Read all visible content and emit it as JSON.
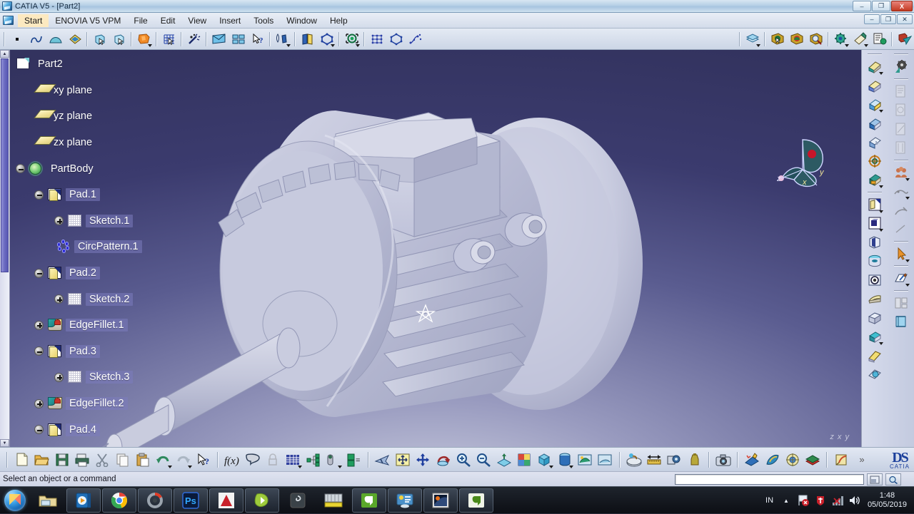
{
  "window": {
    "title": "CATIA V5 - [Part2]",
    "app_icon": "catia-icon",
    "minimize": "–",
    "maximize": "❐",
    "close": "X",
    "doc_minimize": "–",
    "doc_restore": "❐",
    "doc_close": "✕"
  },
  "menubar": {
    "items": [
      {
        "label": "Start",
        "selected": true
      },
      {
        "label": "ENOVIA V5 VPM",
        "selected": false
      },
      {
        "label": "File",
        "selected": false
      },
      {
        "label": "Edit",
        "selected": false
      },
      {
        "label": "View",
        "selected": false
      },
      {
        "label": "Insert",
        "selected": false
      },
      {
        "label": "Tools",
        "selected": false
      },
      {
        "label": "Window",
        "selected": false
      },
      {
        "label": "Help",
        "selected": false
      }
    ]
  },
  "top_toolbar": {
    "groups": [
      {
        "tools": [
          {
            "name": "point-icon"
          },
          {
            "name": "spline-icon"
          },
          {
            "name": "surface-icon"
          },
          {
            "name": "fill-surface-icon"
          }
        ]
      },
      {
        "tools": [
          {
            "name": "select-face-icon"
          },
          {
            "name": "select-solid-icon"
          }
        ]
      },
      {
        "tools": [
          {
            "name": "apply-material-icon",
            "has_caret": true
          }
        ]
      },
      {
        "tools": [
          {
            "name": "grid-select-icon"
          }
        ]
      },
      {
        "tools": [
          {
            "name": "magic-wand-icon"
          }
        ]
      },
      {
        "tools": [
          {
            "name": "email-icon"
          },
          {
            "name": "catalog-icon"
          },
          {
            "name": "whats-this-icon"
          }
        ]
      },
      {
        "tools": [
          {
            "name": "measure-item-icon",
            "has_caret": true
          }
        ]
      },
      {
        "tools": [
          {
            "name": "open-book-icon"
          },
          {
            "name": "polygon-icon",
            "has_caret": true
          }
        ]
      },
      {
        "tools": [
          {
            "name": "sketch-analysis-icon",
            "has_caret": true
          }
        ]
      },
      {
        "tools": [
          {
            "name": "grid-pattern-icon"
          },
          {
            "name": "hexagon-icon"
          },
          {
            "name": "curve-points-icon"
          }
        ]
      },
      {
        "tools": [
          {
            "name": "layers-icon",
            "has_caret": true
          }
        ]
      },
      {
        "tools": [
          {
            "name": "render-scene-icon"
          },
          {
            "name": "apply-color-icon"
          },
          {
            "name": "analyze-render-icon"
          }
        ]
      },
      {
        "tools": [
          {
            "name": "settings-gear-icon",
            "has_caret": true
          },
          {
            "name": "annotation-icon",
            "has_caret": true
          },
          {
            "name": "catalog-browser-icon"
          }
        ]
      },
      {
        "tools": [
          {
            "name": "send-to-icon"
          }
        ]
      }
    ]
  },
  "spec_tree": {
    "root_label": "Part2",
    "nodes": [
      {
        "label": "Part2",
        "icon": "part-icon",
        "indent": 0,
        "toggle": "none",
        "highlight": false
      },
      {
        "label": "xy plane",
        "icon": "plane-icon",
        "indent": 1,
        "toggle": "none",
        "highlight": false
      },
      {
        "label": "yz plane",
        "icon": "plane-icon",
        "indent": 1,
        "toggle": "none",
        "highlight": false
      },
      {
        "label": "zx plane",
        "icon": "plane-icon",
        "indent": 1,
        "toggle": "none",
        "highlight": false
      },
      {
        "label": "PartBody",
        "icon": "partbody-icon",
        "indent": 1,
        "toggle": "minus",
        "highlight": false
      },
      {
        "label": "Pad.1",
        "icon": "pad-icon",
        "indent": 2,
        "toggle": "minus",
        "highlight": true
      },
      {
        "label": "Sketch.1",
        "icon": "sketch-icon",
        "indent": 3,
        "toggle": "plus",
        "highlight": true
      },
      {
        "label": "CircPattern.1",
        "icon": "circpattern-icon",
        "indent": 2,
        "toggle": "none",
        "highlight": true
      },
      {
        "label": "Pad.2",
        "icon": "pad-icon",
        "indent": 2,
        "toggle": "minus",
        "highlight": true
      },
      {
        "label": "Sketch.2",
        "icon": "sketch-icon",
        "indent": 3,
        "toggle": "plus",
        "highlight": true
      },
      {
        "label": "EdgeFillet.1",
        "icon": "fillet-icon",
        "indent": 2,
        "toggle": "plus",
        "highlight": true
      },
      {
        "label": "Pad.3",
        "icon": "pad-icon",
        "indent": 2,
        "toggle": "minus",
        "highlight": true
      },
      {
        "label": "Sketch.3",
        "icon": "sketch-icon",
        "indent": 3,
        "toggle": "plus",
        "highlight": true
      },
      {
        "label": "EdgeFillet.2",
        "icon": "fillet-icon",
        "indent": 2,
        "toggle": "plus",
        "highlight": true
      },
      {
        "label": "Pad.4",
        "icon": "pad-icon",
        "indent": 2,
        "toggle": "minus",
        "highlight": true
      }
    ]
  },
  "viewport": {
    "model_name": "electric-motor-3d-model",
    "background_top_color": "#353566",
    "background_bottom_color": "#c9ccdf",
    "model_color": "#b9bcd4",
    "compass": {
      "x_label": "x",
      "y_label": "y",
      "z_label": "z",
      "handle_color": "#c7152a"
    },
    "axis_triad": "z  x  y",
    "cursor": "selection-star-cursor"
  },
  "right_toolbar": {
    "column_left": [
      {
        "name": "fillet-tool-icon",
        "has_caret": true
      },
      {
        "name": "chamfer-tool-icon"
      },
      {
        "name": "draft-tool-icon",
        "has_caret": true
      },
      {
        "name": "shell-tool-icon"
      },
      {
        "name": "thickness-tool-icon"
      },
      {
        "name": "thread-tool-icon"
      },
      {
        "name": "remove-face-icon",
        "has_caret": true
      },
      {
        "name": "pad-tool-icon",
        "has_caret": true
      },
      {
        "name": "pocket-tool-icon",
        "has_caret": true
      },
      {
        "name": "shaft-tool-icon"
      },
      {
        "name": "groove-tool-icon"
      },
      {
        "name": "hole-tool-icon"
      },
      {
        "name": "rib-tool-icon"
      },
      {
        "name": "slot-tool-icon"
      },
      {
        "name": "multi-section-solid-icon",
        "has_caret": true
      },
      {
        "name": "stiffener-tool-icon"
      },
      {
        "name": "solid-combine-icon"
      }
    ],
    "column_right": [
      {
        "name": "assembly-gear-icon"
      },
      {
        "name": "constraint-1-icon"
      },
      {
        "name": "constraint-2-icon"
      },
      {
        "name": "constraint-3-icon"
      },
      {
        "name": "constraint-4-icon"
      },
      {
        "name": "group-people-icon",
        "has_caret": true
      },
      {
        "name": "scene-icon",
        "has_caret": true
      },
      {
        "name": "annotate-icon"
      },
      {
        "name": "line-analysis-icon"
      },
      {
        "name": "select-arrow-icon",
        "has_caret": true
      },
      {
        "name": "sketcher-icon",
        "has_caret": true
      },
      {
        "name": "drafting-icon"
      },
      {
        "name": "section-view-icon"
      }
    ]
  },
  "bottom_toolbar": {
    "groups": [
      {
        "tools": [
          {
            "name": "new-document-icon"
          },
          {
            "name": "open-folder-icon"
          },
          {
            "name": "save-icon"
          },
          {
            "name": "print-icon"
          },
          {
            "name": "cut-icon"
          },
          {
            "name": "copy-icon"
          },
          {
            "name": "paste-icon"
          },
          {
            "name": "undo-icon",
            "has_caret": true
          },
          {
            "name": "redo-icon",
            "has_caret": true
          },
          {
            "name": "whats-this-icon"
          }
        ]
      },
      {
        "tools": [
          {
            "name": "formula-fx-icon"
          },
          {
            "name": "comment-icon"
          },
          {
            "name": "lock-icon"
          },
          {
            "name": "design-table-icon",
            "has_caret": true
          },
          {
            "name": "knowledge-tree-icon"
          },
          {
            "name": "power-copy-icon",
            "has_caret": true
          },
          {
            "name": "parameters-icon"
          }
        ]
      },
      {
        "tools": [
          {
            "name": "fly-mode-icon"
          },
          {
            "name": "fit-all-in-icon"
          },
          {
            "name": "pan-icon"
          },
          {
            "name": "rotate-icon"
          },
          {
            "name": "zoom-in-icon"
          },
          {
            "name": "zoom-out-icon"
          },
          {
            "name": "normal-view-icon"
          },
          {
            "name": "multi-view-icon"
          },
          {
            "name": "isometric-view-icon",
            "has_caret": true
          },
          {
            "name": "render-style-icon",
            "has_caret": true
          },
          {
            "name": "hide-show-icon"
          },
          {
            "name": "swap-visible-space-icon"
          }
        ]
      },
      {
        "tools": [
          {
            "name": "apply-material-icon"
          },
          {
            "name": "measure-between-icon"
          },
          {
            "name": "measure-item-icon"
          },
          {
            "name": "measure-inertia-icon"
          }
        ]
      },
      {
        "tools": [
          {
            "name": "capture-camera-icon"
          }
        ]
      },
      {
        "tools": [
          {
            "name": "create-scene-icon"
          },
          {
            "name": "photo-studio-icon"
          },
          {
            "name": "simulation-icon"
          },
          {
            "name": "material-library-icon"
          }
        ]
      },
      {
        "tools": [
          {
            "name": "sketch-tracer-icon"
          }
        ]
      }
    ],
    "overflow": "»",
    "logo_main": "DS",
    "logo_sub": "CATIA"
  },
  "statusbar": {
    "message": "Select an object or a command",
    "command_input_value": "",
    "power_input_button": "power-input-icon",
    "search_button": "search-icon"
  },
  "taskbar": {
    "start_button": "windows-start-orb",
    "apps": [
      {
        "name": "windows-explorer-icon"
      },
      {
        "name": "media-player-icon"
      },
      {
        "name": "google-chrome-icon"
      },
      {
        "name": "rainmeter-icon"
      },
      {
        "name": "photoshop-icon",
        "label": "Ps"
      },
      {
        "name": "autocad-icon",
        "label": "A"
      },
      {
        "name": "foxit-reader-icon"
      },
      {
        "name": "spiral-app-icon"
      },
      {
        "name": "keyboard-app-icon"
      },
      {
        "name": "camtasia-icon"
      },
      {
        "name": "control-panel-icon"
      },
      {
        "name": "catia-window-icon"
      },
      {
        "name": "camtasia-window-icon"
      }
    ],
    "tray": {
      "input_language": "IN",
      "show_hidden_icons": "▲",
      "icons": [
        {
          "name": "flag-action-center-icon"
        },
        {
          "name": "antivirus-icon"
        },
        {
          "name": "network-icon"
        },
        {
          "name": "volume-icon"
        }
      ],
      "time": "1:48",
      "date": "05/05/2019"
    }
  }
}
